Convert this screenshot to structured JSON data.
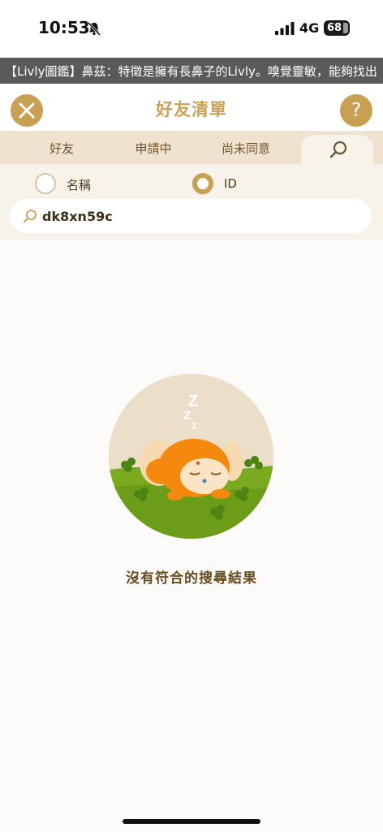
{
  "status_bar": {
    "time": "10:53",
    "network": "4G",
    "battery": "68",
    "icons": [
      "bell-slash-icon",
      "signal-icon",
      "battery-icon"
    ]
  },
  "ticker": {
    "text": "【Livly圖鑑】鼻茲：特徵是擁有長鼻子的Livly。嗅覺靈敏，能夠找出"
  },
  "header": {
    "title": "好友清單",
    "close_icon": "close-icon",
    "help_icon": "help-icon",
    "help_glyph": "?"
  },
  "tabs": [
    {
      "label": "好友"
    },
    {
      "label": "申請中"
    },
    {
      "label": "尚未同意"
    },
    {
      "label": "",
      "icon": "search-icon",
      "selected": true
    }
  ],
  "search": {
    "options": [
      {
        "label": "名稱",
        "selected": false
      },
      {
        "label": "ID",
        "selected": true
      }
    ],
    "value": "dk8xn59c"
  },
  "empty_state": {
    "message": "沒有符合的搜尋結果",
    "illustration": "sleeping-livly-illustration"
  },
  "colors": {
    "accent": "#c7a052",
    "tab_bar": "#efe3cf",
    "panel": "#f7f2ea",
    "ticker": "#5a5a5a",
    "text_brown": "#6b4c1e"
  }
}
